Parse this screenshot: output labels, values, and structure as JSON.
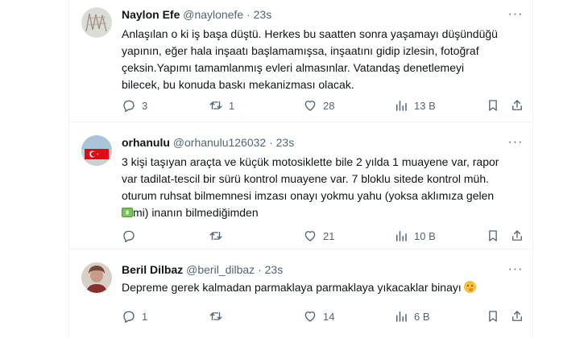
{
  "tweets": [
    {
      "name": "Naylon Efe",
      "handle": "@naylonefe",
      "time": "· 23s",
      "lines": [
        "Anlaşılan o ki iş başa düştü. Herkes bu saatten sonra yaşamayı düşündüğü",
        "yapının, eğer hala inşaatı başlamamışsa, inşaatını gidip izlesin, fotoğraf",
        "çeksin.Yapımı tamamlanmış evleri almasınlar. Vatandaş denetlemeyi",
        "bilecek, bu konuda baskı mekanizması olacak."
      ],
      "replies": "3",
      "retweets": "1",
      "likes": "28",
      "views": "13 B"
    },
    {
      "name": "orhanulu",
      "handle": "@orhanulu126032",
      "time": "· 23s",
      "lines": [
        "3 kişi taşıyan araçta ve küçük motosiklette bile 2 yılda 1 muayene var, rapor",
        "var tadilat-tescil bir sürü kontrol muayene var. 7 bloklu sitede kontrol müh.",
        "oturum ruhsat bilmemnesi imzası onayı yokmu yahu (yoksa aklımıza gelen"
      ],
      "line4_after_emoji": "mi) inanın bilmediğimden",
      "replies": "",
      "retweets": "",
      "likes": "21",
      "views": "10 B"
    },
    {
      "name": "Beril Dilbaz",
      "handle": "@beril_dilbaz",
      "time": "· 23s",
      "lines": [
        "Depreme gerek kalmadan parmaklaya parmaklaya yıkacaklar binayı"
      ],
      "replies": "1",
      "retweets": "",
      "likes": "14",
      "views": "6 B"
    }
  ],
  "icons": {
    "reply": "reply-icon",
    "retweet": "retweet-icon",
    "like": "heart-icon",
    "views": "views-icon",
    "bookmark": "bookmark-icon",
    "share": "share-icon",
    "more": "more-icon"
  },
  "colors": {
    "text": "#0f1419",
    "secondary": "#536471",
    "divider": "#eff3f4"
  }
}
